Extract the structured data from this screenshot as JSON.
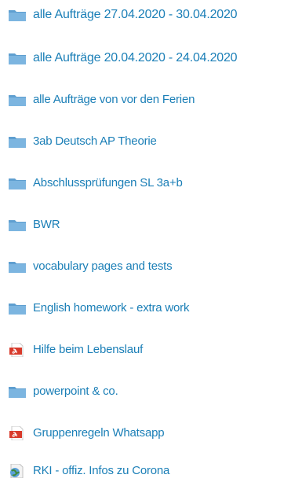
{
  "files": {
    "items": [
      {
        "type": "folder",
        "icon": "folder-icon",
        "label": "alle Aufträge 27.04.2020 - 30.04.2020"
      },
      {
        "type": "folder",
        "icon": "folder-icon",
        "label": "alle Aufträge 20.04.2020 - 24.04.2020"
      },
      {
        "type": "folder",
        "icon": "folder-icon",
        "label": "alle Aufträge von vor den Ferien"
      },
      {
        "type": "folder",
        "icon": "folder-icon",
        "label": "3ab Deutsch AP Theorie"
      },
      {
        "type": "folder",
        "icon": "folder-icon",
        "label": "Abschlussprüfungen SL 3a+b"
      },
      {
        "type": "folder",
        "icon": "folder-icon",
        "label": "BWR"
      },
      {
        "type": "folder",
        "icon": "folder-icon",
        "label": "vocabulary pages and tests"
      },
      {
        "type": "folder",
        "icon": "folder-icon",
        "label": "English homework - extra work"
      },
      {
        "type": "pdf",
        "icon": "pdf-file-icon",
        "label": "Hilfe beim Lebenslauf"
      },
      {
        "type": "folder",
        "icon": "folder-icon",
        "label": "powerpoint & co."
      },
      {
        "type": "pdf",
        "icon": "pdf-file-icon",
        "label": "Gruppenregeln Whatsapp"
      },
      {
        "type": "url",
        "icon": "web-link-icon",
        "label": "RKI - offiz. Infos zu Corona"
      }
    ]
  },
  "colors": {
    "link": "#1b7fb7",
    "folder": "#6aa9d8",
    "pdf": "#d83a2b"
  }
}
